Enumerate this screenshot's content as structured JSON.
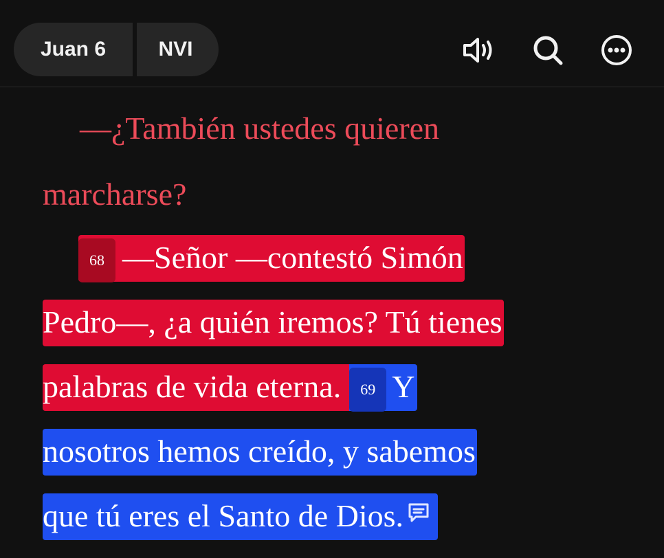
{
  "header": {
    "book_chapter": "Juan 6",
    "version": "NVI",
    "icons": [
      "speaker-icon",
      "search-icon",
      "more-icon"
    ]
  },
  "reader": {
    "lines": {
      "l1": "—¿También ustedes quieren",
      "l2": "marcharse?",
      "v68_number": "68",
      "l3": "—Señor —contestó Simón",
      "l4": "Pedro—, ¿a quién iremos? Tú tienes",
      "l5a": "palabras de vida eterna.",
      "v69_number": "69",
      "l5b": "Y",
      "l6": "nosotros hemos creído, y sabemos",
      "l7": "que tú eres el Santo de Dios."
    }
  },
  "colors": {
    "background": "#111111",
    "words_of_jesus": "#ec4b59",
    "highlight_red": "#df0c33",
    "highlight_blue": "#1f4ff0",
    "pill_background": "#262626"
  }
}
